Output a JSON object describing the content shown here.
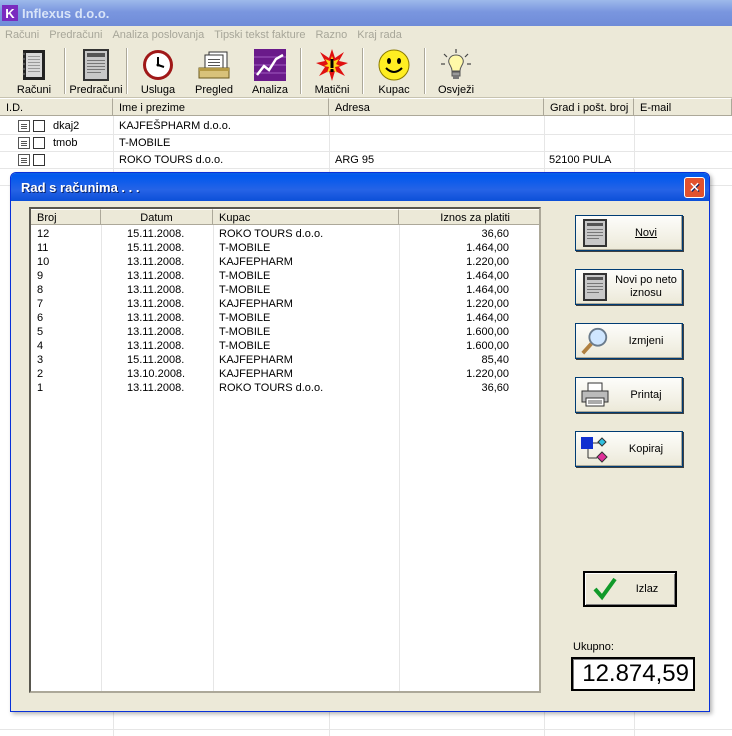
{
  "app": {
    "title": "Inflexus d.o.o.",
    "icon_letter": "K"
  },
  "menu": [
    "Računi",
    "Predračuni",
    "Analiza poslovanja",
    "Tipski tekst fakture",
    "Razno",
    "Kraj rada"
  ],
  "toolbar": [
    {
      "label": "Računi",
      "icon": "notebook-icon"
    },
    {
      "label": "Predračuni",
      "icon": "document-icon"
    },
    {
      "label": "Usluga",
      "icon": "clock-icon"
    },
    {
      "label": "Pregled",
      "icon": "files-icon"
    },
    {
      "label": "Analiza",
      "icon": "chart-icon"
    },
    {
      "label": "Matični",
      "icon": "burst-icon"
    },
    {
      "label": "Kupac",
      "icon": "smiley-icon"
    },
    {
      "label": "Osvježi",
      "icon": "lightbulb-icon"
    }
  ],
  "grid": {
    "columns": [
      "I.D.",
      "Ime i prezime",
      "Adresa",
      "Grad i pošt. broj",
      "E-mail"
    ],
    "rows": [
      {
        "id": "dkaj2",
        "name": "KAJFEŠPHARM d.o.o.",
        "address": "",
        "city": "",
        "email": ""
      },
      {
        "id": "tmob",
        "name": "T-MOBILE",
        "address": "",
        "city": "",
        "email": ""
      },
      {
        "id": "",
        "name": "ROKO TOURS d.o.o.",
        "address": "ARG 95",
        "city": "52100 PULA",
        "email": ""
      }
    ]
  },
  "dialog": {
    "title": "Rad s računima . . .",
    "close_symbol": "✕",
    "columns": [
      "Broj",
      "Datum",
      "Kupac",
      "Iznos za platiti"
    ],
    "invoices": [
      {
        "no": "12",
        "date": "15.11.2008.",
        "customer": "ROKO TOURS d.o.o.",
        "amount": "36,60"
      },
      {
        "no": "11",
        "date": "15.11.2008.",
        "customer": "T-MOBILE",
        "amount": "1.464,00"
      },
      {
        "no": "10",
        "date": "13.11.2008.",
        "customer": "KAJFEPHARM",
        "amount": "1.220,00"
      },
      {
        "no": "9",
        "date": "13.11.2008.",
        "customer": "T-MOBILE",
        "amount": "1.464,00"
      },
      {
        "no": "8",
        "date": "13.11.2008.",
        "customer": "T-MOBILE",
        "amount": "1.464,00"
      },
      {
        "no": "7",
        "date": "13.11.2008.",
        "customer": "KAJFEPHARM",
        "amount": "1.220,00"
      },
      {
        "no": "6",
        "date": "13.11.2008.",
        "customer": "T-MOBILE",
        "amount": "1.464,00"
      },
      {
        "no": "5",
        "date": "13.11.2008.",
        "customer": "T-MOBILE",
        "amount": "1.600,00"
      },
      {
        "no": "4",
        "date": "13.11.2008.",
        "customer": "T-MOBILE",
        "amount": "1.600,00"
      },
      {
        "no": "3",
        "date": "15.11.2008.",
        "customer": "KAJFEPHARM",
        "amount": "85,40"
      },
      {
        "no": "2",
        "date": "13.10.2008.",
        "customer": "KAJFEPHARM",
        "amount": "1.220,00"
      },
      {
        "no": "1",
        "date": "13.11.2008.",
        "customer": "ROKO TOURS d.o.o.",
        "amount": "36,60"
      }
    ],
    "buttons": {
      "new": "Novi",
      "new_net": "Novi po neto iznosu",
      "edit": "Izmjeni",
      "print": "Printaj",
      "copy": "Kopiraj",
      "exit": "Izlaz"
    },
    "total_label": "Ukupno:",
    "total_value": "12.874,59"
  }
}
